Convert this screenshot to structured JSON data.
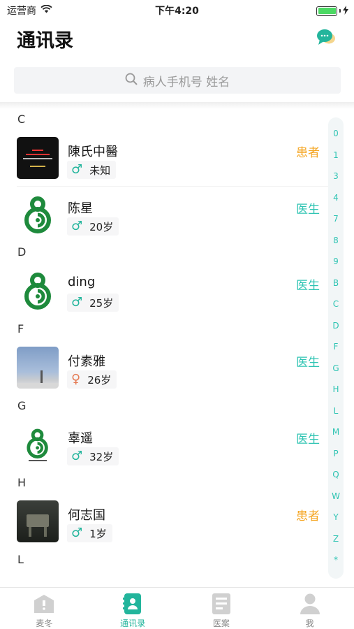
{
  "status_bar": {
    "carrier": "运营商",
    "time": "下午4:20"
  },
  "header": {
    "title": "通讯录"
  },
  "search": {
    "placeholder": "病人手机号 姓名"
  },
  "sections": [
    {
      "letter": "C",
      "contacts": [
        {
          "name": "陳氏中醫",
          "gender": "♂",
          "age": "未知",
          "role": "患者",
          "role_type": "patient",
          "avatar": "dark-logo"
        },
        {
          "name": "陈星",
          "gender": "♂",
          "age": "20岁",
          "role": "医生",
          "role_type": "doctor",
          "avatar": "gourd-logo"
        }
      ]
    },
    {
      "letter": "D",
      "contacts": [
        {
          "name": "ding",
          "gender": "♂",
          "age": "25岁",
          "role": "医生",
          "role_type": "doctor",
          "avatar": "gourd-logo"
        }
      ]
    },
    {
      "letter": "F",
      "contacts": [
        {
          "name": "付素雅",
          "gender": "♀",
          "age": "26岁",
          "role": "医生",
          "role_type": "doctor",
          "avatar": "sky-photo"
        }
      ]
    },
    {
      "letter": "G",
      "contacts": [
        {
          "name": "辜遥",
          "gender": "♂",
          "age": "32岁",
          "role": "医生",
          "role_type": "doctor",
          "avatar": "gourd-logo-small"
        }
      ]
    },
    {
      "letter": "H",
      "contacts": [
        {
          "name": "何志国",
          "gender": "♂",
          "age": "1岁",
          "role": "患者",
          "role_type": "patient",
          "avatar": "bronze-photo"
        }
      ]
    },
    {
      "letter": "L",
      "contacts": []
    }
  ],
  "index_letters": [
    "0",
    "1",
    "3",
    "4",
    "7",
    "8",
    "9",
    "B",
    "C",
    "D",
    "F",
    "G",
    "H",
    "L",
    "M",
    "P",
    "Q",
    "W",
    "Y",
    "Z",
    "*"
  ],
  "tabs": [
    {
      "label": "麦冬",
      "icon": "house-icon",
      "active": false
    },
    {
      "label": "通讯录",
      "icon": "contacts-icon",
      "active": true
    },
    {
      "label": "医案",
      "icon": "medical-record-icon",
      "active": false
    },
    {
      "label": "我",
      "icon": "person-icon",
      "active": false
    }
  ],
  "colors": {
    "accent": "#23b59c",
    "doctor": "#2fc4b3",
    "patient": "#f5a623",
    "female": "#e57a53"
  }
}
